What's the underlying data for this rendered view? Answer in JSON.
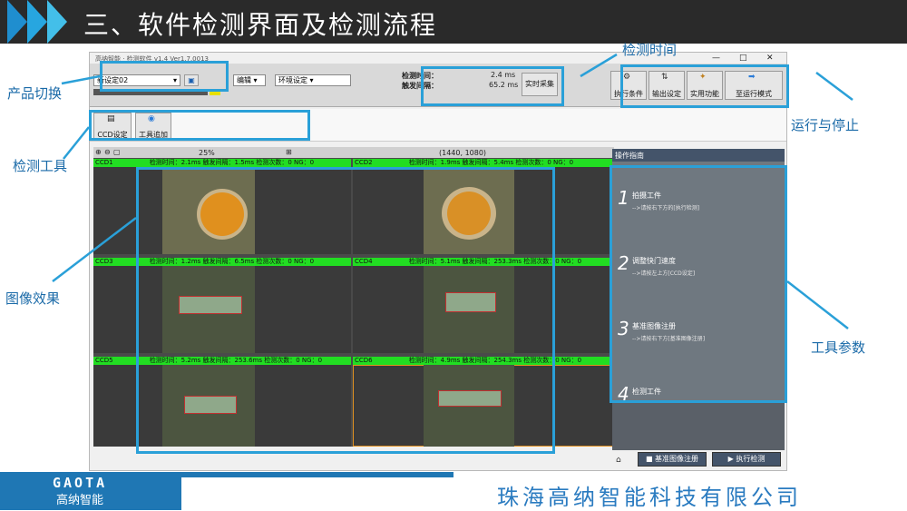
{
  "slide": {
    "title": "三、软件检测界面及检测流程",
    "brand_logo_text": "GAOTA",
    "brand_name": "高纳智能",
    "company": "珠海高纳智能科技有限公司"
  },
  "annotations": {
    "product_switch": "产品切换",
    "detect_time": "检测时间",
    "detect_tools": "检测工具",
    "run_stop": "运行与停止",
    "image_effect": "图像效果",
    "tool_params": "工具参数"
  },
  "app": {
    "window_title": "高纳智能 · 检测软件 v1.4 Ver1.7.0013",
    "product_select": "新设定02",
    "edit_menu": "编辑",
    "env_menu": "环境设定",
    "detect_time_label": "检测时间：",
    "detect_time_value": "2.4 ms",
    "trigger_interval_label": "触发间隔：",
    "trigger_interval_value": "65.2 ms",
    "realtime_capture": "实时采集",
    "exec_condition": "执行条件",
    "output_settings": "输出设定",
    "utility": "实用功能",
    "run_mode": "至运行模式",
    "ccd_settings": "CCD设定",
    "tool_add": "工具追加",
    "zoom": "25%",
    "coords": "(1440, 1080)",
    "guide_title": "操作指南",
    "steps": [
      {
        "num": "1",
        "title": "拍摄工件",
        "sub": "-->请按右下方的[执行检测]"
      },
      {
        "num": "2",
        "title": "调整快门速度",
        "sub": "-->请按左上方[CCD设定]"
      },
      {
        "num": "3",
        "title": "基准图像注册",
        "sub": "-->请按右下方[基准图像注册]"
      },
      {
        "num": "4",
        "title": "检测工件",
        "sub": "-->请按右下方[执行检测]"
      }
    ],
    "register_button": "基准图像注册",
    "execute_button": "执行检测",
    "ccd": [
      {
        "name": "CCD1",
        "info": "检测时间：2.1ms  触发间隔：1.5ms  检测次数：0  NG：0"
      },
      {
        "name": "CCD2",
        "info": "检测时间：1.9ms  触发间隔：5.4ms  检测次数：0  NG：0"
      },
      {
        "name": "CCD3",
        "info": "检测时间：1.2ms  触发间隔：6.5ms  检测次数：0  NG：0"
      },
      {
        "name": "CCD4",
        "info": "检测时间：5.1ms  触发间隔：253.3ms  检测次数：0  NG：0"
      },
      {
        "name": "CCD5",
        "info": "检测时间：5.2ms  触发间隔：253.6ms  检测次数：0  NG：0"
      },
      {
        "name": "CCD6",
        "info": "检测时间：4.9ms  触发间隔：254.3ms  检测次数：0  NG：0"
      }
    ]
  },
  "colors": {
    "accent": "#2aa0d8",
    "status_bar": "#22dd22",
    "company_text": "#2a7bc0",
    "footer_bg": "#1f77b4"
  }
}
